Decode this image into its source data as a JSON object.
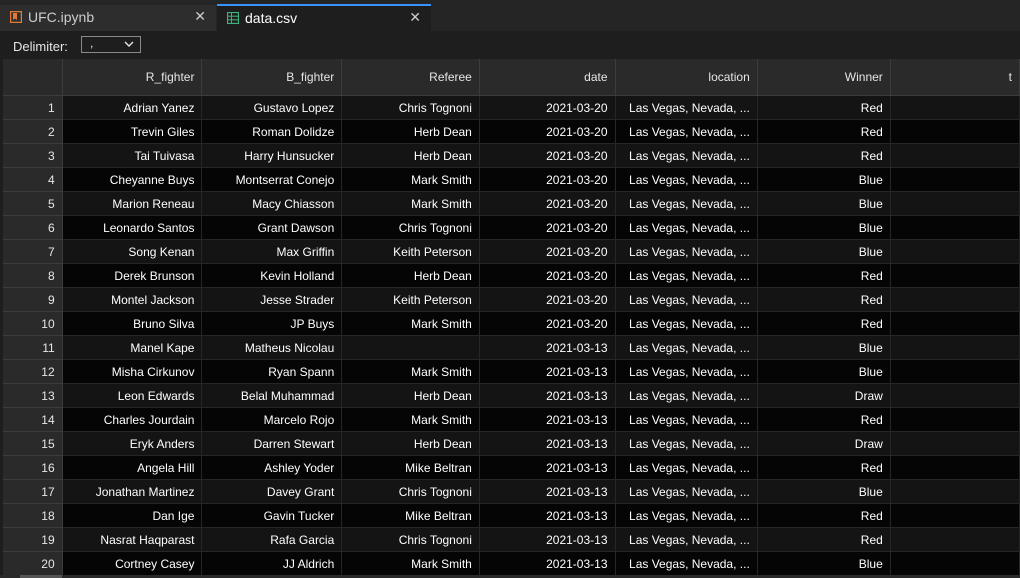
{
  "tabs": [
    {
      "label": "UFC.ipynb",
      "icon": "notebook-icon",
      "active": false,
      "close": "✕"
    },
    {
      "label": "data.csv",
      "icon": "csv-grid-icon",
      "active": true,
      "close": "✕"
    }
  ],
  "toolbar": {
    "delimiter_label": "Delimiter:",
    "delimiter_value": ","
  },
  "table": {
    "columns": [
      "R_fighter",
      "B_fighter",
      "Referee",
      "date",
      "location",
      "Winner",
      "t"
    ],
    "rows": [
      [
        "1",
        "Adrian Yanez",
        "Gustavo Lopez",
        "Chris Tognoni",
        "2021-03-20",
        "Las Vegas, Nevada, ...",
        "Red"
      ],
      [
        "2",
        "Trevin Giles",
        "Roman Dolidze",
        "Herb Dean",
        "2021-03-20",
        "Las Vegas, Nevada, ...",
        "Red"
      ],
      [
        "3",
        "Tai Tuivasa",
        "Harry Hunsucker",
        "Herb Dean",
        "2021-03-20",
        "Las Vegas, Nevada, ...",
        "Red"
      ],
      [
        "4",
        "Cheyanne Buys",
        "Montserrat Conejo",
        "Mark Smith",
        "2021-03-20",
        "Las Vegas, Nevada, ...",
        "Blue"
      ],
      [
        "5",
        "Marion Reneau",
        "Macy Chiasson",
        "Mark Smith",
        "2021-03-20",
        "Las Vegas, Nevada, ...",
        "Blue"
      ],
      [
        "6",
        "Leonardo Santos",
        "Grant Dawson",
        "Chris Tognoni",
        "2021-03-20",
        "Las Vegas, Nevada, ...",
        "Blue"
      ],
      [
        "7",
        "Song Kenan",
        "Max Griffin",
        "Keith Peterson",
        "2021-03-20",
        "Las Vegas, Nevada, ...",
        "Blue"
      ],
      [
        "8",
        "Derek Brunson",
        "Kevin Holland",
        "Herb Dean",
        "2021-03-20",
        "Las Vegas, Nevada, ...",
        "Red"
      ],
      [
        "9",
        "Montel Jackson",
        "Jesse Strader",
        "Keith Peterson",
        "2021-03-20",
        "Las Vegas, Nevada, ...",
        "Red"
      ],
      [
        "10",
        "Bruno Silva",
        "JP Buys",
        "Mark Smith",
        "2021-03-20",
        "Las Vegas, Nevada, ...",
        "Red"
      ],
      [
        "11",
        "Manel Kape",
        "Matheus Nicolau",
        "",
        "2021-03-13",
        "Las Vegas, Nevada, ...",
        "Blue"
      ],
      [
        "12",
        "Misha Cirkunov",
        "Ryan Spann",
        "Mark Smith",
        "2021-03-13",
        "Las Vegas, Nevada, ...",
        "Blue"
      ],
      [
        "13",
        "Leon Edwards",
        "Belal Muhammad",
        "Herb Dean",
        "2021-03-13",
        "Las Vegas, Nevada, ...",
        "Draw"
      ],
      [
        "14",
        "Charles Jourdain",
        "Marcelo Rojo",
        "Mark Smith",
        "2021-03-13",
        "Las Vegas, Nevada, ...",
        "Red"
      ],
      [
        "15",
        "Eryk Anders",
        "Darren Stewart",
        "Herb Dean",
        "2021-03-13",
        "Las Vegas, Nevada, ...",
        "Draw"
      ],
      [
        "16",
        "Angela Hill",
        "Ashley Yoder",
        "Mike Beltran",
        "2021-03-13",
        "Las Vegas, Nevada, ...",
        "Red"
      ],
      [
        "17",
        "Jonathan Martinez",
        "Davey Grant",
        "Chris Tognoni",
        "2021-03-13",
        "Las Vegas, Nevada, ...",
        "Blue"
      ],
      [
        "18",
        "Dan Ige",
        "Gavin Tucker",
        "Mike Beltran",
        "2021-03-13",
        "Las Vegas, Nevada, ...",
        "Red"
      ],
      [
        "19",
        "Nasrat Haqparast",
        "Rafa Garcia",
        "Chris Tognoni",
        "2021-03-13",
        "Las Vegas, Nevada, ...",
        "Red"
      ],
      [
        "20",
        "Cortney Casey",
        "JJ Aldrich",
        "Mark Smith",
        "2021-03-13",
        "Las Vegas, Nevada, ...",
        "Blue"
      ]
    ]
  },
  "colors": {
    "accent": "#3794ff",
    "notebook_icon": "#e37933",
    "csv_icon": "#3fb37f"
  }
}
